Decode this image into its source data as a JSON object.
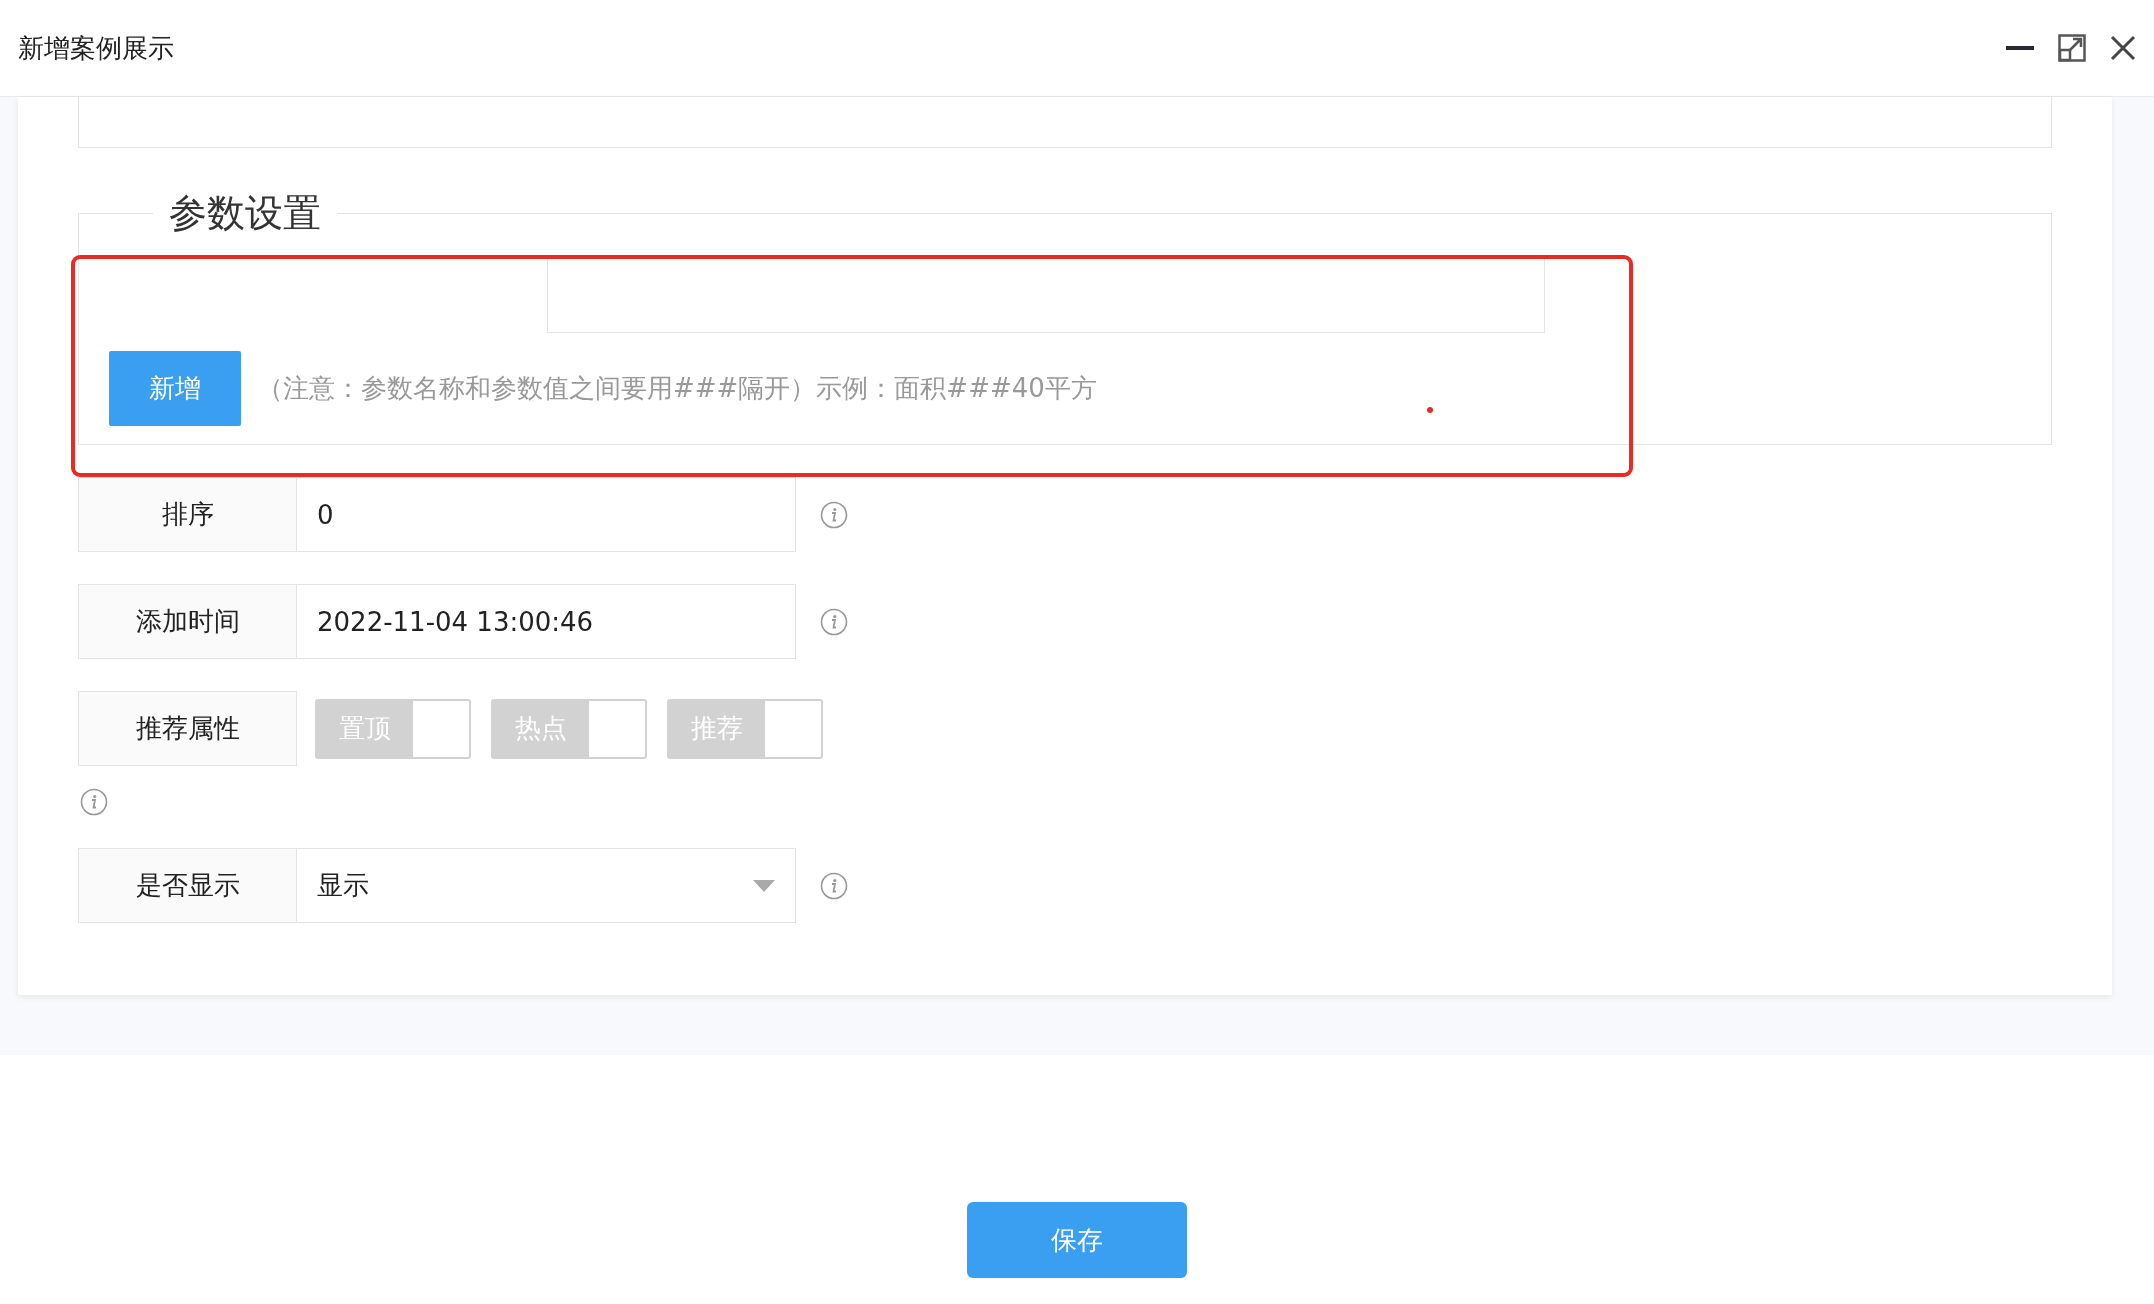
{
  "window": {
    "title": "新增案例展示"
  },
  "param_section": {
    "legend": "参数设置",
    "add_button": "新增",
    "note": "（注意：参数名称和参数值之间要用###隔开）示例：面积###40平方"
  },
  "fields": [
    {
      "kind": "text",
      "label": "排序",
      "value": "0"
    },
    {
      "kind": "text",
      "label": "添加时间",
      "value": "2022-11-04 13:00:46"
    },
    {
      "kind": "toggles",
      "label": "推荐属性",
      "toggles": [
        {
          "label": "置顶",
          "on": false
        },
        {
          "label": "热点",
          "on": false
        },
        {
          "label": "推荐",
          "on": false
        }
      ]
    },
    {
      "kind": "select",
      "label": "是否显示",
      "value": "显示"
    }
  ],
  "save_button": "保存"
}
